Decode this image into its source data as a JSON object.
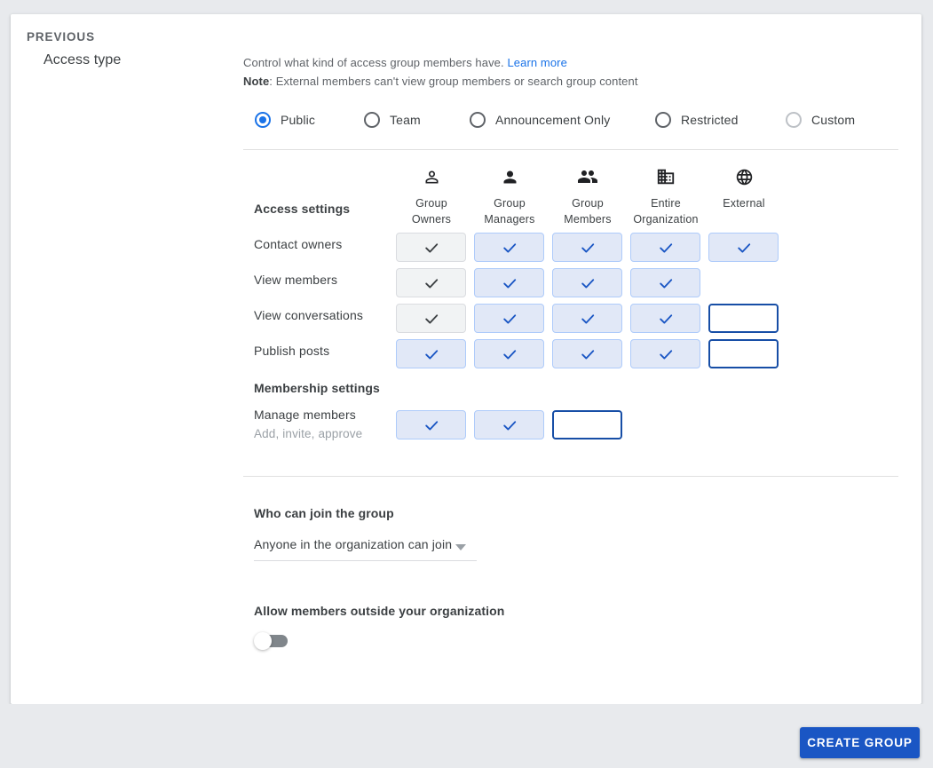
{
  "section": {
    "title": "Access type",
    "description_text": "Control what kind of access group members have.",
    "learn_more": "Learn more",
    "note_label": "Note",
    "note_text": ": External members can't view group members or search group content"
  },
  "access_type": {
    "options": [
      {
        "label": "Public",
        "selected": true,
        "disabled": false
      },
      {
        "label": "Team",
        "selected": false,
        "disabled": false
      },
      {
        "label": "Announcement Only",
        "selected": false,
        "disabled": false
      },
      {
        "label": "Restricted",
        "selected": false,
        "disabled": false
      },
      {
        "label": "Custom",
        "selected": false,
        "disabled": true
      }
    ]
  },
  "access_table": {
    "heading": "Access settings",
    "columns": [
      {
        "label": "Group\nOwners",
        "line1": "Group",
        "line2": "Owners",
        "icon": "person-outline-icon"
      },
      {
        "label": "Group\nManagers",
        "line1": "Group",
        "line2": "Managers",
        "icon": "person-filled-icon"
      },
      {
        "label": "Group\nMembers",
        "line1": "Group",
        "line2": "Members",
        "icon": "people-icon"
      },
      {
        "label": "Entire\nOrganization",
        "line1": "Entire",
        "line2": "Organization",
        "icon": "building-icon"
      },
      {
        "label": "External",
        "line1": "External",
        "line2": "",
        "icon": "globe-icon"
      }
    ],
    "rows": [
      {
        "label": "Contact owners",
        "cells": [
          "disabled",
          "checked",
          "checked",
          "checked",
          "checked"
        ]
      },
      {
        "label": "View members",
        "cells": [
          "disabled",
          "checked",
          "checked",
          "checked",
          "blank"
        ]
      },
      {
        "label": "View conversations",
        "cells": [
          "disabled",
          "checked",
          "checked",
          "checked",
          "empty"
        ]
      },
      {
        "label": "Publish posts",
        "cells": [
          "checked",
          "checked",
          "checked",
          "checked",
          "empty"
        ]
      }
    ]
  },
  "membership": {
    "heading": "Membership settings",
    "row": {
      "label": "Manage members",
      "sublabel": "Add, invite, approve",
      "cells": [
        "checked",
        "checked",
        "empty"
      ]
    }
  },
  "join": {
    "label": "Who can join the group",
    "selected_value": "Anyone in the organization can join"
  },
  "external_members": {
    "label": "Allow members outside your organization",
    "toggle_state": "off"
  },
  "footer": {
    "previous_label": "PREVIOUS",
    "create_label": "CREATE GROUP"
  },
  "colors": {
    "accent": "#1a73e8",
    "primary_button": "#1a56c4",
    "checked_cell_bg": "#e1e8f7",
    "checked_cell_border": "#aecbfa",
    "empty_cell_border": "#174ea6",
    "disabled_cell_bg": "#f1f3f4",
    "page_background": "#e8eaed",
    "link": "#1a73e8",
    "muted_text": "#5f6368"
  }
}
